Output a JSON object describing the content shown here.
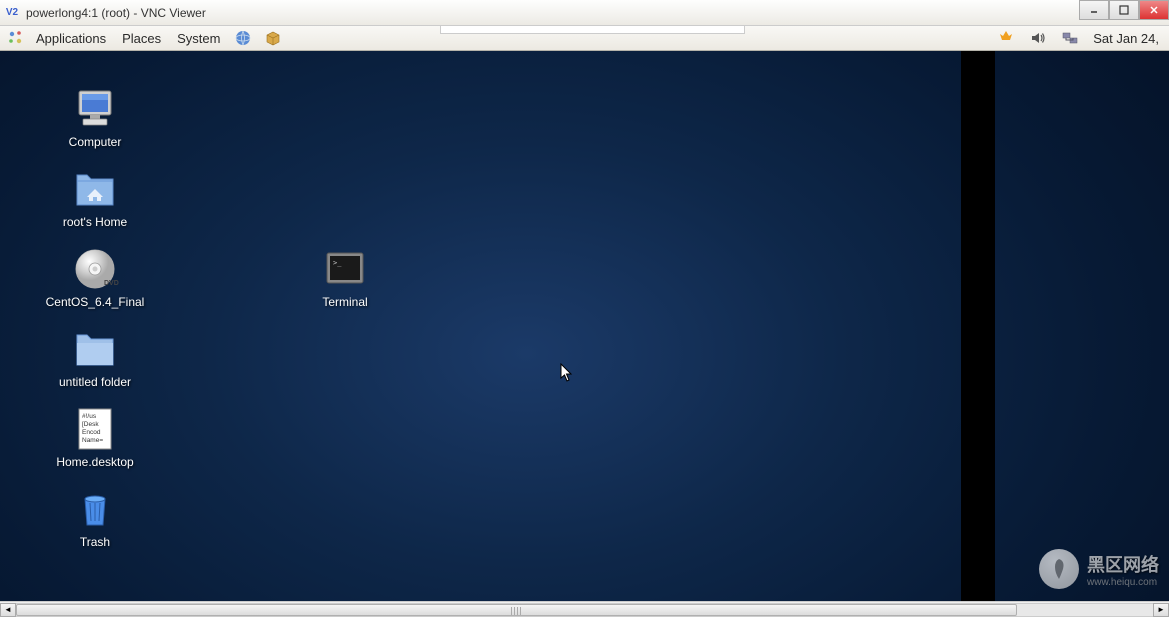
{
  "window": {
    "title": "powerlong4:1 (root) - VNC Viewer",
    "logo_text": "V2"
  },
  "panel": {
    "menus": {
      "applications": "Applications",
      "places": "Places",
      "system": "System"
    },
    "system_tray": {
      "update_icon": "update-icon",
      "sound_icon": "sound-icon",
      "network_icon": "network-icon"
    },
    "date": "Sat Jan 24,"
  },
  "desktop": {
    "icons": {
      "computer": "Computer",
      "roots_home": "root's Home",
      "centos": "CentOS_6.4_Final",
      "untitled": "untitled folder",
      "home_desktop": "Home.desktop",
      "trash": "Trash",
      "terminal": "Terminal"
    },
    "home_desktop_content": {
      "l1": "#!/us",
      "l2": "[Desk",
      "l3": "Encod",
      "l4": "Name="
    }
  },
  "watermark": {
    "text": "黑区网络",
    "url": "www.heiqu.com"
  }
}
